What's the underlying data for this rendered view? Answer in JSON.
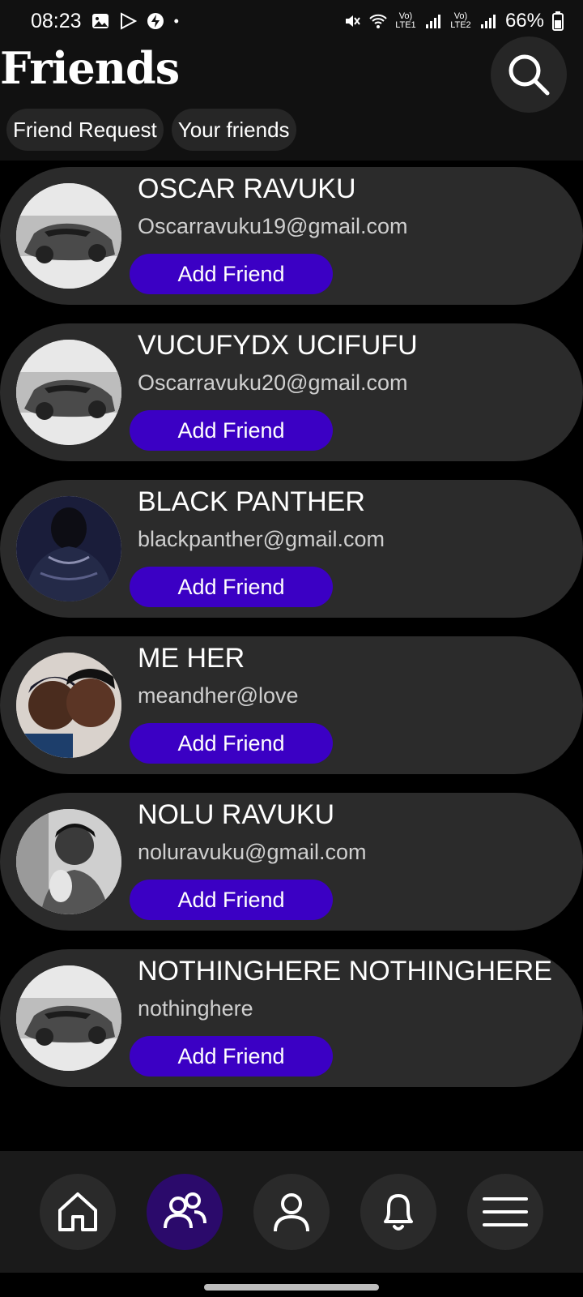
{
  "status_bar": {
    "time": "08:23",
    "lte1_label": "Vo) LTE1",
    "lte2_label": "Vo) LTE2",
    "battery": "66%"
  },
  "header": {
    "title": "Friends",
    "tabs": [
      "Friend Request",
      "Your friends"
    ]
  },
  "friends": [
    {
      "name": "OSCAR RAVUKU",
      "email": "Oscarravuku19@gmail.com",
      "button": "Add Friend",
      "avatar": "car"
    },
    {
      "name": "VUCUFYDX UCIFUFU",
      "email": "Oscarravuku20@gmail.com",
      "button": "Add Friend",
      "avatar": "car"
    },
    {
      "name": "BLACK PANTHER",
      "email": "blackpanther@gmail.com",
      "button": "Add Friend",
      "avatar": "panther"
    },
    {
      "name": "ME HER",
      "email": "meandher@love",
      "button": "Add Friend",
      "avatar": "couple"
    },
    {
      "name": "NOLU RAVUKU",
      "email": "noluravuku@gmail.com",
      "button": "Add Friend",
      "avatar": "portrait"
    },
    {
      "name": "NOTHINGHERE NOTHINGHERE",
      "email": "nothinghere",
      "button": "Add Friend",
      "avatar": "car"
    }
  ],
  "bottom_nav": {
    "items": [
      "home-icon",
      "friends-icon",
      "profile-icon",
      "bell-icon",
      "menu-icon"
    ],
    "active": "friends-icon"
  },
  "colors": {
    "accent": "#3b00c4",
    "active_nav": "#2b0a6b",
    "card": "#2b2b2b"
  }
}
